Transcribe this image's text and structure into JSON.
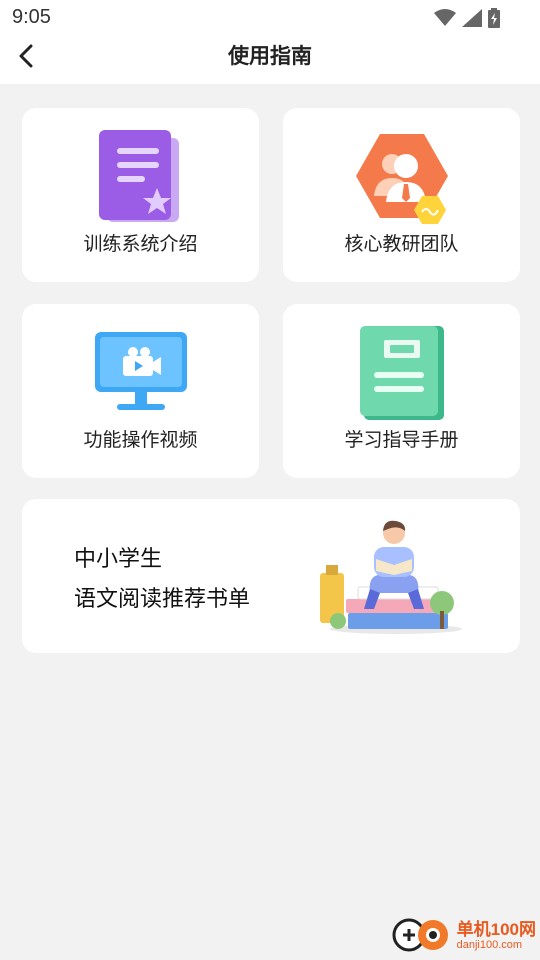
{
  "status": {
    "time": "9:05"
  },
  "header": {
    "title": "使用指南"
  },
  "cards": [
    {
      "label": "训练系统介绍",
      "icon": "document-star-icon"
    },
    {
      "label": "核心教研团队",
      "icon": "team-avatar-icon"
    },
    {
      "label": "功能操作视频",
      "icon": "video-monitor-icon"
    },
    {
      "label": "学习指导手册",
      "icon": "green-book-icon"
    }
  ],
  "banner": {
    "line1": "中小学生",
    "line2": "语文阅读推荐书单",
    "icon": "reading-boy-illustration"
  },
  "watermark": {
    "brand": "单机100网",
    "url": "danji100.com"
  }
}
